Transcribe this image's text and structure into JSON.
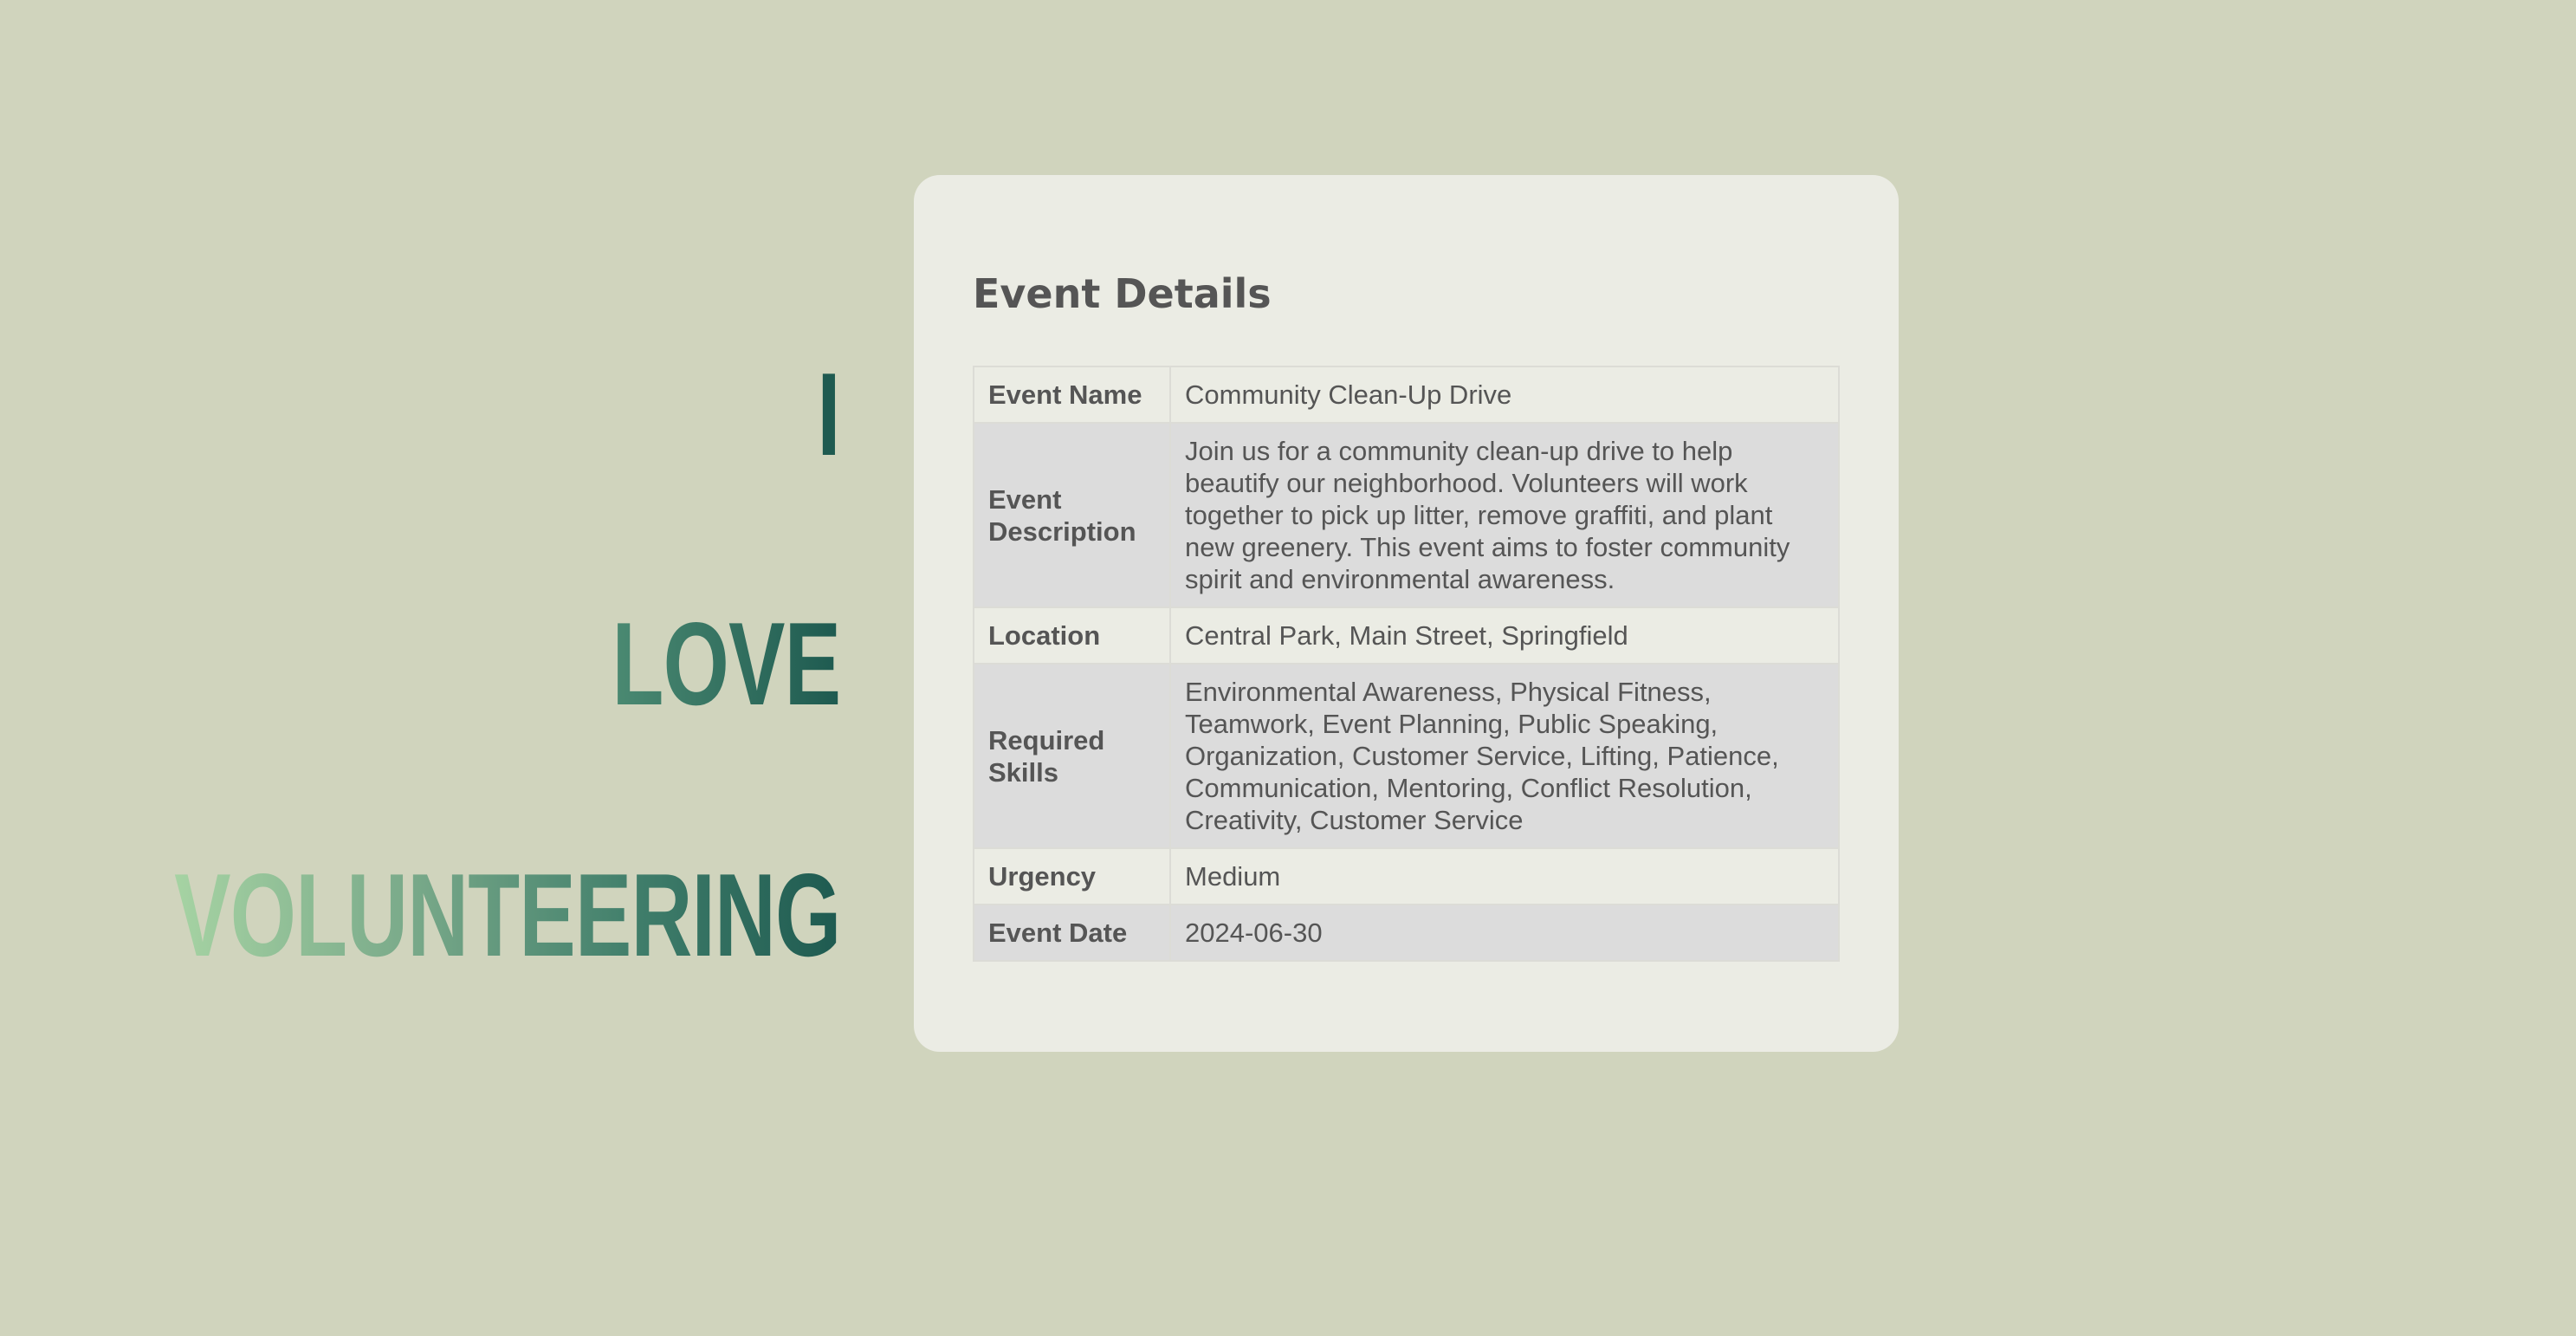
{
  "slogan": {
    "line1": "I",
    "line2": "LOVE",
    "line3": "VOLUNTEERING"
  },
  "card": {
    "title": "Event Details",
    "rows": [
      {
        "label": "Event Name",
        "value": "Community Clean-Up Drive"
      },
      {
        "label": "Event Description",
        "value": "Join us for a community clean-up drive to help beautify our neighborhood. Volunteers will work together to pick up litter, remove graffiti, and plant new greenery. This event aims to foster community spirit and environmental awareness."
      },
      {
        "label": "Location",
        "value": "Central Park, Main Street, Springfield"
      },
      {
        "label": "Required Skills",
        "value": "Environmental Awareness, Physical Fitness, Teamwork, Event Planning, Public Speaking, Organization, Customer Service, Lifting, Patience, Communication, Mentoring, Conflict Resolution, Creativity, Customer Service"
      },
      {
        "label": "Urgency",
        "value": "Medium"
      },
      {
        "label": "Event Date",
        "value": "2024-06-30"
      }
    ]
  },
  "colors": {
    "background": "#d0d4bd",
    "card": "#ebece4",
    "row_alt": "#dcdcdc",
    "text": "#555555",
    "slogan_dark": "#1e5a50",
    "slogan_light": "#a6d3a3"
  }
}
